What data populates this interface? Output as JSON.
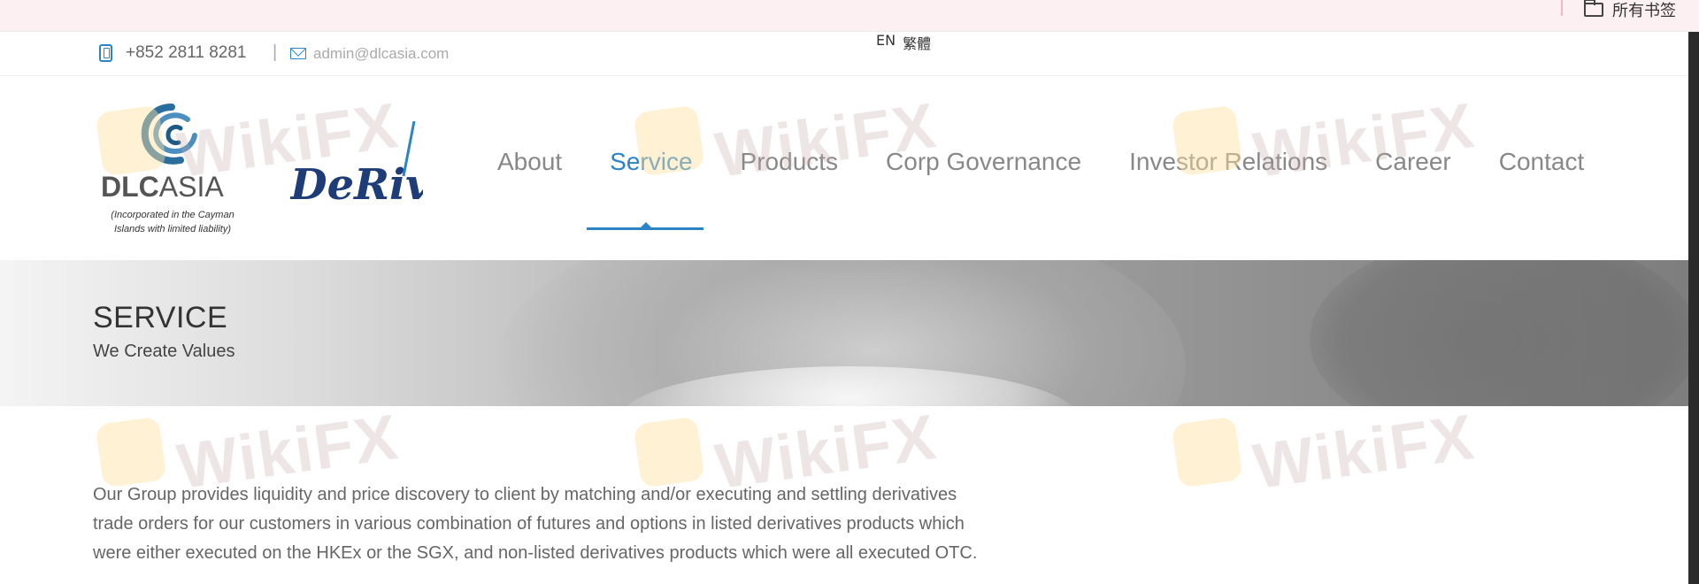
{
  "browser": {
    "bookmarks_label": "所有书签",
    "folder_icon": "folder-icon"
  },
  "topbar": {
    "phone": "+852 2811 8281",
    "divider": "|",
    "email": "admin@dlcasia.com",
    "languages": [
      "EN",
      "繁體"
    ],
    "icons": [
      "phone-icon",
      "mail-icon"
    ]
  },
  "logo": {
    "name_bold": "DLC",
    "name_light": "ASIA",
    "subtitle_line1": "(Incorporated in the Cayman",
    "subtitle_line2": "Islands with limited liability)",
    "partner": "DeRiva"
  },
  "nav": {
    "items": [
      "About",
      "Service",
      "Products",
      "Corp Governance",
      "Investor Relations",
      "Career",
      "Contact"
    ],
    "active": "Service"
  },
  "banner": {
    "title": "SERVICE",
    "subtitle": "We Create Values"
  },
  "main": {
    "paragraph_line1": "Our Group provides liquidity and price discovery to client by matching and/or executing and settling derivatives",
    "paragraph_line2": "trade orders for our customers in various combination of futures and options in listed derivatives products which",
    "paragraph_line3": "were either executed on the HKEx or the SGX, and non-listed derivatives products which were all executed OTC."
  },
  "watermark": {
    "text": "WikiFX"
  },
  "colors": {
    "accent": "#2a84c6",
    "nav_text": "#888888",
    "bookmark_bar": "#fdf0f3"
  }
}
